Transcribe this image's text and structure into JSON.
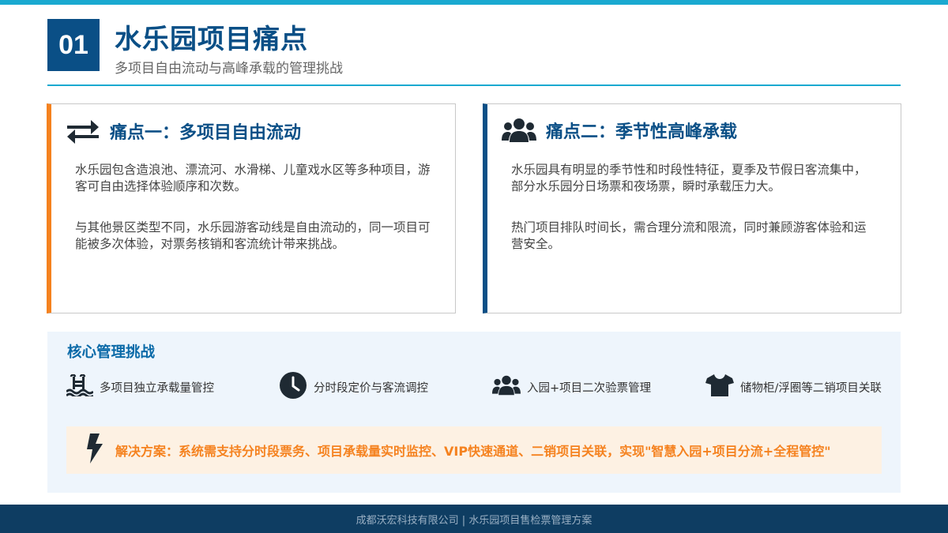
{
  "header": {
    "number": "01",
    "title": "水乐园项目痛点",
    "subtitle": "多项目自由流动与高峰承载的管理挑战"
  },
  "colors": {
    "primary": "#0a4f86",
    "accent_orange": "#f5821f",
    "accent_cyan": "#1aa9d0",
    "footer_bg": "#0e3d62"
  },
  "cards": [
    {
      "icon": "exchange-arrows-icon",
      "title": "痛点一：多项目自由流动",
      "paragraphs": [
        "水乐园包含造浪池、漂流河、水滑梯、儿童戏水区等多种项目，游客可自由选择体验顺序和次数。",
        "与其他景区类型不同，水乐园游客动线是自由流动的，同一项目可能被多次体验，对票务核销和客流统计带来挑战。"
      ]
    },
    {
      "icon": "users-icon",
      "title": "痛点二：季节性高峰承载",
      "paragraphs": [
        "水乐园具有明显的季节性和时段性特征，夏季及节假日客流集中，部分水乐园分日场票和夜场票，瞬时承载压力大。",
        "热门项目排队时间长，需合理分流和限流，同时兼顾游客体验和运营安全。"
      ]
    }
  ],
  "core": {
    "title": "核心管理挑战",
    "items": [
      {
        "icon": "swimming-pool-icon",
        "label": "多项目独立承载量管控"
      },
      {
        "icon": "clock-icon",
        "label": "分时段定价与客流调控"
      },
      {
        "icon": "users-icon",
        "label": "入园+项目二次验票管理"
      },
      {
        "icon": "tshirt-icon",
        "label": "储物柜/浮圈等二销项目关联"
      }
    ],
    "solution": {
      "icon": "lightning-bolt-icon",
      "text": "解决方案：系统需支持分时段票务、项目承载量实时监控、VIP快速通道、二销项目关联，实现\"智慧入园+项目分流+全程管控\""
    }
  },
  "footer": {
    "text": "成都沃宏科技有限公司 | 水乐园项目售检票管理方案"
  }
}
